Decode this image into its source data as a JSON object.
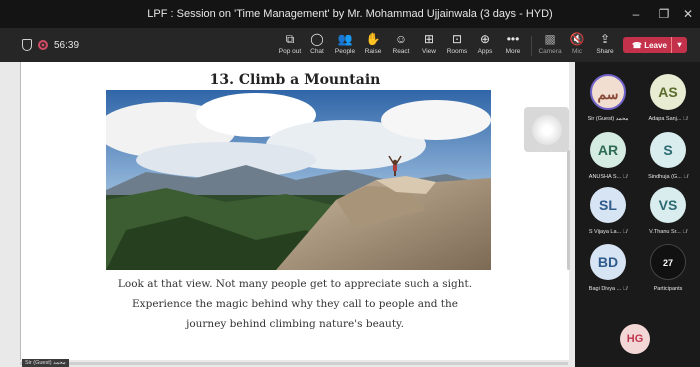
{
  "window": {
    "title": "LPF : Session on 'Time Management' by Mr. Mohammad Ujjainwala (3 days - HYD)"
  },
  "meeting": {
    "timer": "56:39"
  },
  "toolbar": {
    "items": [
      {
        "label": "Pop out",
        "icon": "pop-out-icon"
      },
      {
        "label": "Chat",
        "icon": "chat-icon"
      },
      {
        "label": "People",
        "icon": "people-icon"
      },
      {
        "label": "Raise",
        "icon": "raise-hand-icon"
      },
      {
        "label": "React",
        "icon": "react-icon"
      },
      {
        "label": "View",
        "icon": "view-icon"
      },
      {
        "label": "Rooms",
        "icon": "rooms-icon"
      },
      {
        "label": "Apps",
        "icon": "apps-icon"
      },
      {
        "label": "More",
        "icon": "more-icon"
      },
      {
        "label": "Camera",
        "icon": "camera-icon"
      },
      {
        "label": "Mic",
        "icon": "mic-icon"
      },
      {
        "label": "Share",
        "icon": "share-icon"
      }
    ],
    "leave_label": "Leave"
  },
  "slide": {
    "title": "13. Climb a Mountain",
    "caption_lines": [
      "Look at that view. Not many people get to appreciate such a sight.",
      "Experience the magic behind why they call to people and the",
      "journey behind climbing nature's beauty."
    ]
  },
  "presenter_tag": "Sir (Guest) محمد",
  "participants": [
    {
      "initials": "سم",
      "name": "Sir (Guest) محمد",
      "bg": "#f2ddd1",
      "fg": "#8a4a3a",
      "muted": false
    },
    {
      "initials": "AS",
      "name": "Adapa Sanj...",
      "bg": "#e7ecd2",
      "fg": "#5a6b2c",
      "muted": true
    },
    {
      "initials": "AR",
      "name": "ANUSHA S...",
      "bg": "#d5ece3",
      "fg": "#2e6b56",
      "muted": true
    },
    {
      "initials": "S",
      "name": "Sindhuja (G...",
      "bg": "#d9ecee",
      "fg": "#2d6a72",
      "muted": true
    },
    {
      "initials": "SL",
      "name": "S Vijaya La...",
      "bg": "#d7e4f3",
      "fg": "#2f5a8a",
      "muted": true
    },
    {
      "initials": "VS",
      "name": "V.Thanu Sr...",
      "bg": "#d9ecee",
      "fg": "#2d6a72",
      "muted": true
    },
    {
      "initials": "BD",
      "name": "Bagi Divya ...",
      "bg": "#d7e4f3",
      "fg": "#2f5a8a",
      "muted": true
    }
  ],
  "participants_count": {
    "value": "27",
    "label": "Participants"
  },
  "self_tile": {
    "initials": "HG"
  }
}
